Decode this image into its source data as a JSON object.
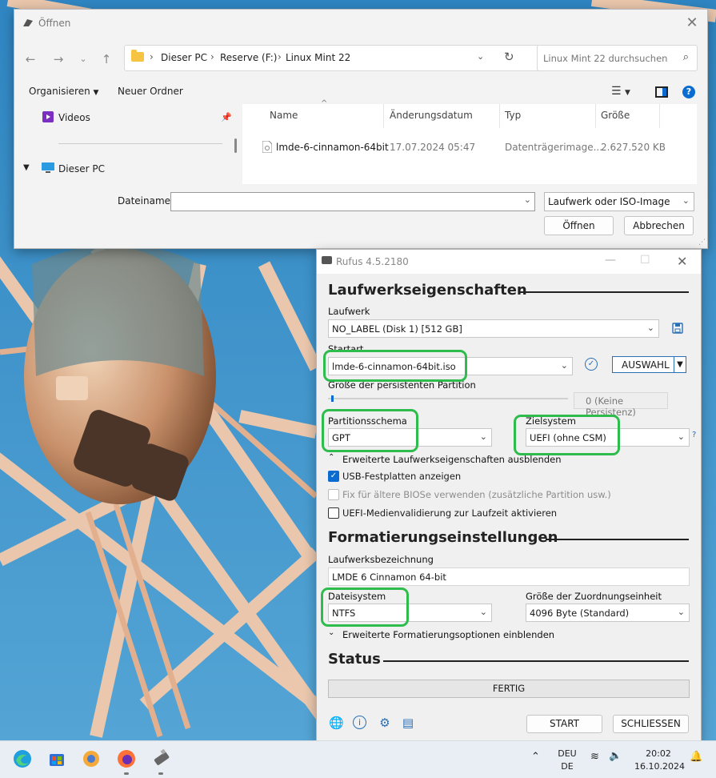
{
  "open_dialog": {
    "title": "Öffnen",
    "breadcrumb": [
      "Dieser PC",
      "Reserve (F:)",
      "Linux Mint 22"
    ],
    "search_placeholder": "Linux Mint 22 durchsuchen",
    "toolbar": {
      "organize": "Organisieren",
      "new_folder": "Neuer Ordner"
    },
    "nav_pane": {
      "videos": "Videos",
      "this_pc": "Dieser PC"
    },
    "columns": [
      "Name",
      "Änderungsdatum",
      "Typ",
      "Größe"
    ],
    "files": [
      {
        "name": "lmde-6-cinnamon-64bit",
        "date": "17.07.2024 05:47",
        "type": "Datenträgerimage...",
        "size": "2.627.520 KB"
      }
    ],
    "filename_label": "Dateiname:",
    "filename_value": "",
    "filetype": "Laufwerk oder ISO-Image",
    "open_button": "Öffnen",
    "cancel_button": "Abbrechen"
  },
  "rufus": {
    "title": "Rufus 4.5.2180",
    "drive_properties_header": "Laufwerkseigenschaften",
    "drive_label": "Laufwerk",
    "drive_value": "NO_LABEL (Disk 1) [512 GB]",
    "boot_label": "Startart",
    "boot_value": "lmde-6-cinnamon-64bit.iso",
    "select_button": "AUSWAHL",
    "persistence_label": "Größe der persistenten Partition",
    "persistence_value": "0 (Keine Persistenz)",
    "partition_label": "Partitionsschema",
    "partition_value": "GPT",
    "target_label": "Zielsystem",
    "target_value": "UEFI (ohne CSM)",
    "target_help": "?",
    "advanced_drive_toggle": "Erweiterte Laufwerkseigenschaften ausblenden",
    "check_usb_hdd": "USB-Festplatten anzeigen",
    "check_bios_fix": "Fix für ältere BIOSe verwenden (zusätzliche Partition usw.)",
    "check_uefi_validation": "UEFI-Medienvalidierung zur Laufzeit aktivieren",
    "format_header": "Formatierungseinstellungen",
    "volume_label_label": "Laufwerksbezeichnung",
    "volume_label_value": "LMDE 6 Cinnamon 64-bit",
    "filesystem_label": "Dateisystem",
    "filesystem_value": "NTFS",
    "cluster_label": "Größe der Zuordnungseinheit",
    "cluster_value": "4096 Byte (Standard)",
    "advanced_format_toggle": "Erweiterte Formatierungsoptionen einblenden",
    "status_header": "Status",
    "status_value": "FERTIG",
    "start_button": "START",
    "close_button": "SCHLIESSEN"
  },
  "taskbar": {
    "lang_top": "DEU",
    "lang_bottom": "DE",
    "time": "20:02",
    "date": "16.10.2024",
    "apps": [
      "edge-icon",
      "store-icon",
      "settings-icon",
      "firefox-icon",
      "usb-drive-icon"
    ]
  },
  "colors": {
    "highlight": "#2ebd4d",
    "accent": "#0a6cd1"
  }
}
